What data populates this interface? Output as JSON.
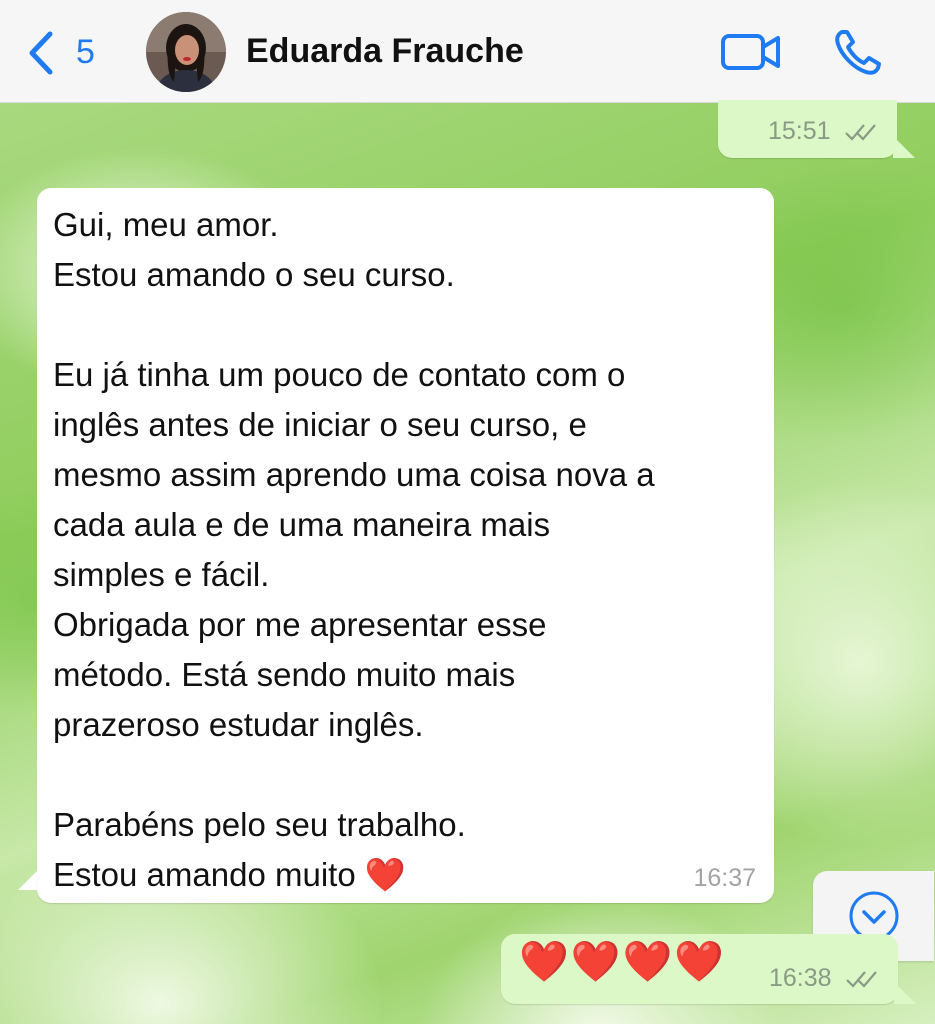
{
  "header": {
    "back_count": "5",
    "contact_name": "Eduarda Frauche"
  },
  "messages": [
    {
      "direction": "outgoing",
      "time": "15:51",
      "status": "read"
    },
    {
      "direction": "incoming",
      "text": "Gui, meu amor.\nEstou amando o seu curso.\n\nEu já tinha um pouco de contato com o\ninglês antes de iniciar o seu curso, e\nmesmo assim aprendo uma coisa nova a\ncada aula e de uma maneira mais\nsimples e fácil.\nObrigada por me apresentar esse\nmétodo. Está sendo muito mais\nprazeroso estudar inglês.\n\nParabéns pelo seu trabalho.\nEstou amando muito ❤️",
      "time": "16:37"
    },
    {
      "direction": "outgoing",
      "text": "❤️❤️❤️❤️",
      "time": "16:38",
      "status": "read"
    }
  ],
  "icons": {
    "back": "chevron-left-icon",
    "video": "video-camera-icon",
    "phone": "phone-icon",
    "scroll": "chevron-down-circle-icon",
    "read_ticks": "double-check-icon"
  },
  "colors": {
    "accent": "#1f7bf2",
    "outgoing_bubble": "#dcf8c6",
    "incoming_bubble": "#ffffff",
    "heart": "#e3242b"
  }
}
